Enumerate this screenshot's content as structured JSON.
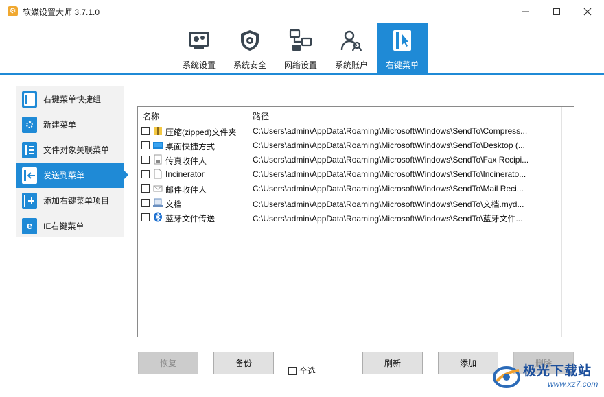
{
  "window": {
    "title": "软媒设置大师 3.7.1.0"
  },
  "toolbar": {
    "items": [
      {
        "label": "系统设置",
        "icon": "system-settings-icon"
      },
      {
        "label": "系统安全",
        "icon": "shield-gear-icon"
      },
      {
        "label": "网络设置",
        "icon": "network-icon"
      },
      {
        "label": "系统账户",
        "icon": "users-icon"
      },
      {
        "label": "右键菜单",
        "icon": "cursor-menu-icon",
        "active": true
      }
    ]
  },
  "sidebar": {
    "items": [
      {
        "label": "右键菜单快捷组",
        "icon": "menu-group-icon"
      },
      {
        "label": "新建菜单",
        "icon": "new-menu-icon"
      },
      {
        "label": "文件对象关联菜单",
        "icon": "file-list-icon"
      },
      {
        "label": "发送到菜单",
        "icon": "send-to-icon",
        "active": true
      },
      {
        "label": "添加右键菜单项目",
        "icon": "add-item-icon"
      },
      {
        "label": "IE右键菜单",
        "icon": "ie-icon"
      }
    ]
  },
  "list": {
    "columns": {
      "name": "名称",
      "path": "路径"
    },
    "rows": [
      {
        "name": "压缩(zipped)文件夹",
        "path": "C:\\Users\\admin\\AppData\\Roaming\\Microsoft\\Windows\\SendTo\\Compress...",
        "icon": "zip-folder-icon"
      },
      {
        "name": "桌面快捷方式",
        "path": "C:\\Users\\admin\\AppData\\Roaming\\Microsoft\\Windows\\SendTo\\Desktop (...",
        "icon": "desktop-icon"
      },
      {
        "name": "传真收件人",
        "path": "C:\\Users\\admin\\AppData\\Roaming\\Microsoft\\Windows\\SendTo\\Fax Recipi...",
        "icon": "fax-icon"
      },
      {
        "name": "Incinerator",
        "path": "C:\\Users\\admin\\AppData\\Roaming\\Microsoft\\Windows\\SendTo\\Incinerato...",
        "icon": "blank-file-icon"
      },
      {
        "name": "邮件收件人",
        "path": "C:\\Users\\admin\\AppData\\Roaming\\Microsoft\\Windows\\SendTo\\Mail Reci...",
        "icon": "mail-icon"
      },
      {
        "name": "文档",
        "path": "C:\\Users\\admin\\AppData\\Roaming\\Microsoft\\Windows\\SendTo\\文档.myd...",
        "icon": "documents-icon"
      },
      {
        "name": "蓝牙文件传送",
        "path": "C:\\Users\\admin\\AppData\\Roaming\\Microsoft\\Windows\\SendTo\\蓝牙文件...",
        "icon": "bluetooth-icon"
      }
    ]
  },
  "buttons": {
    "restore": "恢复",
    "backup": "备份",
    "select_all": "全选",
    "refresh": "刷新",
    "add": "添加",
    "delete": "删除"
  },
  "watermark": {
    "text": "极光下载站",
    "url": "www.xz7.com"
  },
  "colors": {
    "accent": "#1f8ad6",
    "sidebar_bg": "#f2f2f2",
    "disabled_button": "#cccccc"
  }
}
